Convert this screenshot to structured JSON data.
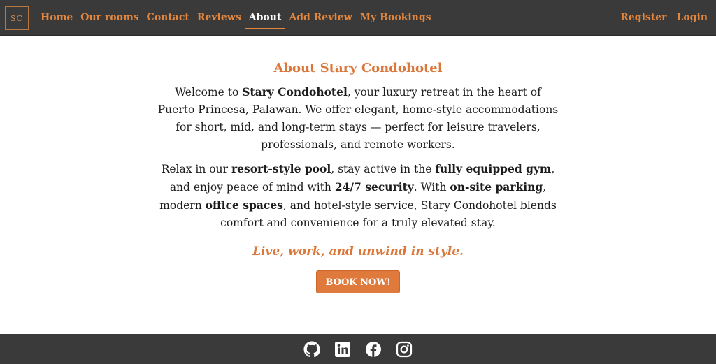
{
  "nav": {
    "logo_text": "SC",
    "links": [
      {
        "label": "Home"
      },
      {
        "label": "Our rooms"
      },
      {
        "label": "Contact"
      },
      {
        "label": "Reviews"
      },
      {
        "label": "About",
        "active": true
      },
      {
        "label": "Add Review"
      },
      {
        "label": "My Bookings"
      }
    ],
    "right_links": [
      {
        "label": "Register"
      },
      {
        "label": "Login"
      }
    ]
  },
  "about": {
    "title": "About Stary Condohotel",
    "p1_a": "Welcome to ",
    "p1_b": "Stary Condohotel",
    "p1_c": ", your luxury retreat in the heart of Puerto Princesa, Palawan. We offer elegant, home-style accommodations for short, mid, and long-term stays — perfect for leisure travelers, professionals, and remote workers.",
    "p2_a": "Relax in our ",
    "p2_b": "resort-style pool",
    "p2_c": ", stay active in the ",
    "p2_d": "fully equipped gym",
    "p2_e": ", and enjoy peace of mind with ",
    "p2_f": "24/7 security",
    "p2_g": ". With ",
    "p2_h": "on-site parking",
    "p2_i": ", modern ",
    "p2_j": "office spaces",
    "p2_k": ", and hotel-style service, Stary Condohotel blends comfort and convenience for a truly elevated stay.",
    "tagline": "Live, work, and unwind in style.",
    "button_label": "BOOK NOW!"
  },
  "footer": {
    "icons": [
      "github-icon",
      "linkedin-icon",
      "facebook-icon",
      "instagram-icon"
    ]
  },
  "colors": {
    "accent": "#e3873f",
    "navbar_bg": "#3a3a3a",
    "button_bg": "#e07a3c",
    "text": "#1c1c1c"
  }
}
